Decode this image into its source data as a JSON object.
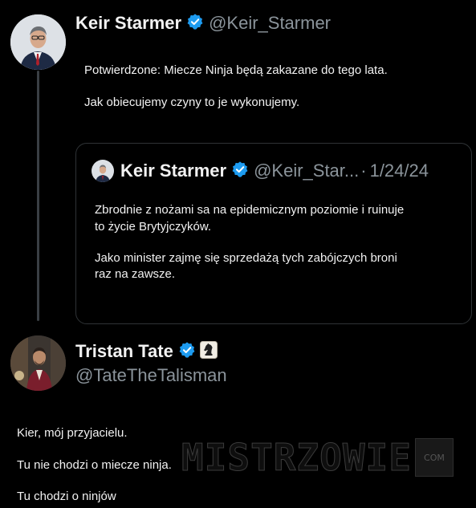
{
  "tweet": {
    "author_name": "Keir Starmer",
    "author_handle": "@Keir_Starmer",
    "text_line1": "Potwierdzone: Miecze Ninja będą zakazane do tego lata.",
    "text_line2": "Jak obiecujemy czyny to je wykonujemy."
  },
  "quote": {
    "author_name": "Keir Starmer",
    "author_handle": "@Keir_Star...",
    "separator": "·",
    "date": "1/24/24",
    "p1_line1": "Zbrodnie z nożami sa na epidemicznym poziomie i ruinuje",
    "p1_line2": "to życie Brytyjczyków.",
    "p2_line1": "Jako minister zajmę się sprzedażą tych zabójczych broni",
    "p2_line2": "raz na zawsze."
  },
  "reply": {
    "author_name": "Tristan Tate",
    "author_handle": "@TateTheTalisman",
    "line1": "Kier, mój przyjacielu.",
    "line2": "Tu nie chodzi o miecze ninja.",
    "line3": "Tu chodzi o ninjów"
  },
  "watermark": {
    "text": "MISTRZOWIE",
    "box_text": "COM"
  },
  "colors": {
    "background": "#000000",
    "verified_badge": "#1d9bf0",
    "handle_gray": "#8b949b",
    "text": "#f2f2f2"
  },
  "icons": [
    "verified-badge-icon",
    "chess-knight-icon"
  ]
}
